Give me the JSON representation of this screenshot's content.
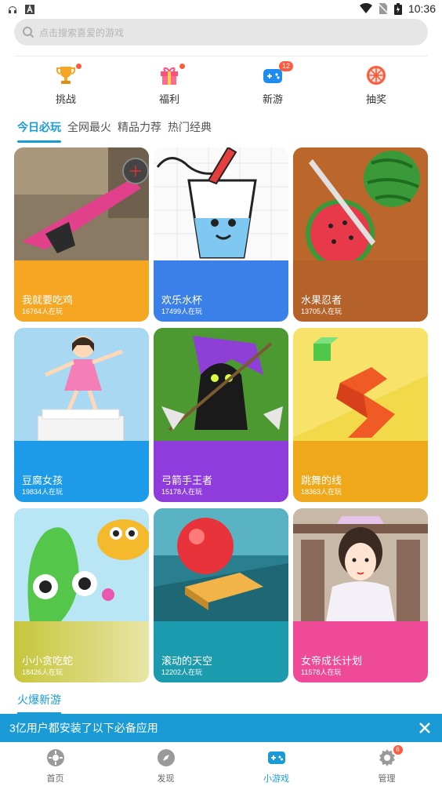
{
  "status_bar": {
    "time": "10:36"
  },
  "search": {
    "placeholder": "点击搜索喜爱的游戏"
  },
  "quick_actions": [
    {
      "label": "挑战",
      "icon": "trophy-icon",
      "indicator": "dot"
    },
    {
      "label": "福利",
      "icon": "gift-icon",
      "indicator": "dot"
    },
    {
      "label": "新游",
      "icon": "gamepad-icon",
      "badge": "12"
    },
    {
      "label": "抽奖",
      "icon": "lottery-wheel-icon"
    }
  ],
  "tabs": [
    "今日必玩",
    "全网最火",
    "精品力荐",
    "热门经典"
  ],
  "active_tab": "今日必玩",
  "games": [
    {
      "title": "我就要吃鸡",
      "players": "16764人在玩",
      "color": "#f5a623"
    },
    {
      "title": "欢乐水杯",
      "players": "17499人在玩",
      "color": "#3b7fe8"
    },
    {
      "title": "水果忍者",
      "players": "13705人在玩",
      "color": "#b5622a"
    },
    {
      "title": "豆腐女孩",
      "players": "19834人在玩",
      "color": "#1e9be8"
    },
    {
      "title": "弓箭手王者",
      "players": "15178人在玩",
      "color": "#8f3cdc"
    },
    {
      "title": "跳舞的线",
      "players": "18363人在玩",
      "color": "#f0a81b"
    },
    {
      "title": "小小贪吃蛇",
      "players": "18426人在玩",
      "color": "#c6c63c"
    },
    {
      "title": "滚动的天空",
      "players": "12202人在玩",
      "color": "#1d9bae"
    },
    {
      "title": "女帝成长计划",
      "players": "11578人在玩",
      "color": "#ef4a98"
    }
  ],
  "section_title": "火爆新游",
  "banner": {
    "text": "3亿用户都安装了以下必备应用"
  },
  "bottom_nav": [
    {
      "label": "首页",
      "icon": "home-icon"
    },
    {
      "label": "发现",
      "icon": "compass-icon"
    },
    {
      "label": "小游戏",
      "icon": "mini-game-icon",
      "active": true
    },
    {
      "label": "管理",
      "icon": "settings-icon",
      "badge": "6"
    }
  ],
  "colors": {
    "accent": "#1a9bd6",
    "badge": "#ff5a3c"
  }
}
